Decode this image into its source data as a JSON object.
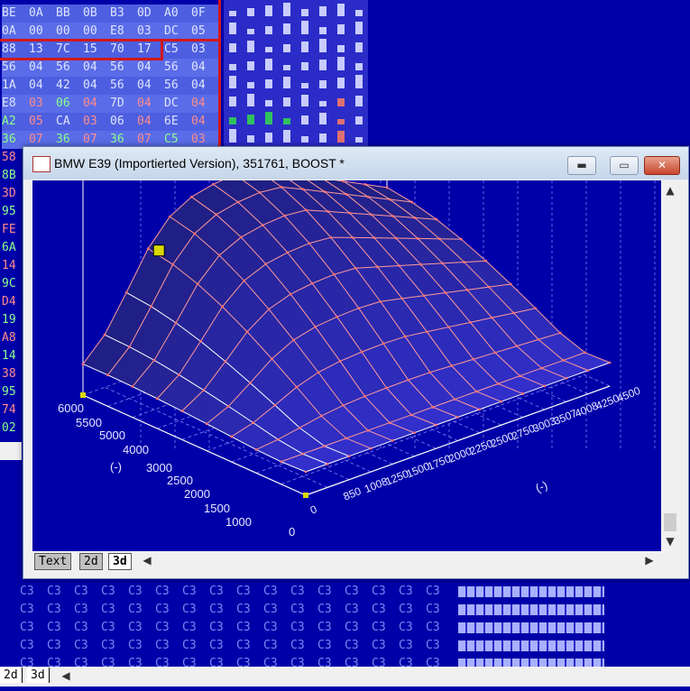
{
  "hex_top": {
    "rows": [
      [
        "BE",
        "0A",
        "BB",
        "0B",
        "B3",
        "0D",
        "A0",
        "0F"
      ],
      [
        "0A",
        "00",
        "00",
        "00",
        "E8",
        "03",
        "DC",
        "05"
      ],
      [
        "88",
        "13",
        "7C",
        "15",
        "70",
        "17",
        "C5",
        "03"
      ],
      [
        "56",
        "04",
        "56",
        "04",
        "56",
        "04",
        "56",
        "04"
      ],
      [
        "1A",
        "04",
        "42",
        "04",
        "56",
        "04",
        "56",
        "04"
      ],
      [
        "E8",
        "03",
        "06",
        "04",
        "7D",
        "04",
        "DC",
        "04"
      ],
      [
        "A2",
        "05",
        "CA",
        "03",
        "06",
        "04",
        "6E",
        "04"
      ],
      [
        "36",
        "07",
        "36",
        "07",
        "36",
        "07",
        "C5",
        "03"
      ]
    ],
    "left_column": [
      "58",
      "8B",
      "3D",
      "95",
      "FE",
      "6A",
      "14",
      "9C",
      "D4",
      "19",
      "A8",
      "14",
      "38",
      "95",
      "74",
      "02"
    ]
  },
  "hex_bottom": {
    "rows": [
      [
        "C3",
        "C3",
        "C3",
        "C3",
        "C3",
        "C3",
        "C3",
        "C3",
        "C3",
        "C3",
        "C3",
        "C3",
        "C3",
        "C3",
        "C3",
        "C3"
      ],
      [
        "C3",
        "C3",
        "C3",
        "C3",
        "C3",
        "C3",
        "C3",
        "C3",
        "C3",
        "C3",
        "C3",
        "C3",
        "C3",
        "C3",
        "C3",
        "C3"
      ],
      [
        "C3",
        "C3",
        "C3",
        "C3",
        "C3",
        "C3",
        "C3",
        "C3",
        "C3",
        "C3",
        "C3",
        "C3",
        "C3",
        "C3",
        "C3",
        "C3"
      ],
      [
        "C3",
        "C3",
        "C3",
        "C3",
        "C3",
        "C3",
        "C3",
        "C3",
        "C3",
        "C3",
        "C3",
        "C3",
        "C3",
        "C3",
        "C3",
        "C3"
      ],
      [
        "C3",
        "C3",
        "C3",
        "C3",
        "C3",
        "C3",
        "C3",
        "C3",
        "C3",
        "C3",
        "C3",
        "C3",
        "C3",
        "C3",
        "C3",
        "C3"
      ]
    ]
  },
  "window": {
    "title": "BMW E39 (Importierted Version), 351761, BOOST *",
    "minimize": "▬",
    "maximize": "▭",
    "close": "✕",
    "tabs": [
      "Text",
      "2d",
      "3d"
    ],
    "active_tab": "3d"
  },
  "bottom_tabs": [
    "2d",
    "3d"
  ],
  "scroll": {
    "up": "▲",
    "down": "▼",
    "left": "◀",
    "right": "▶"
  },
  "chart_data": {
    "type": "surface",
    "y_ticks": [
      "6000",
      "5500",
      "5000",
      "4000",
      "3000",
      "2500",
      "2000",
      "1500",
      "1000",
      "0"
    ],
    "y_label": "(-)",
    "x_ticks": [
      "0",
      "850",
      "1008",
      "1250",
      "1500",
      "1750",
      "2000",
      "2250",
      "2500",
      "2750",
      "3003",
      "3507",
      "4008",
      "4250",
      "4500"
    ],
    "x_label": "(-)",
    "z_min": 0,
    "colors": {
      "mesh_line": "#ffffff",
      "mesh_node": "#ff7070",
      "face": "#3b38d8",
      "grid": "#9090ff",
      "highlight": "#d8d800"
    }
  }
}
